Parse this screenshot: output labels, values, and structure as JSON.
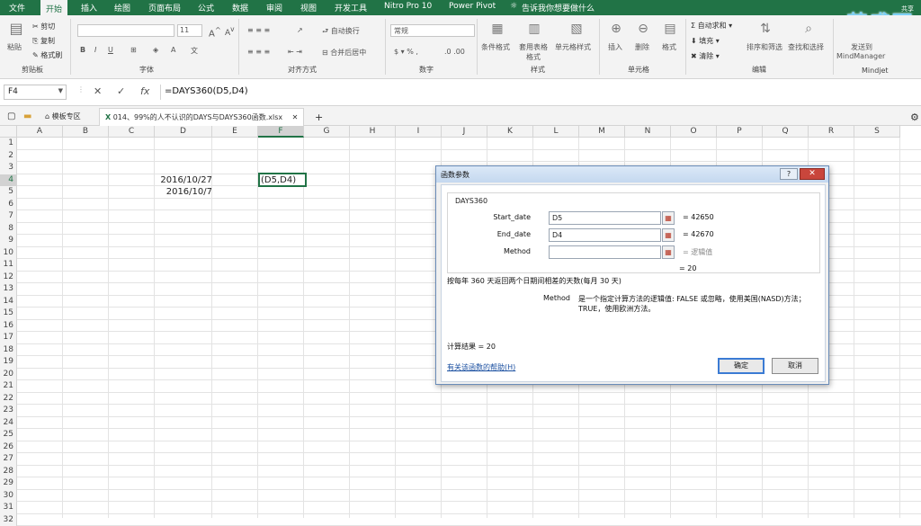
{
  "menu": {
    "tabs": [
      "文件",
      "开始",
      "插入",
      "绘图",
      "页面布局",
      "公式",
      "数据",
      "审阅",
      "视图",
      "开发工具",
      "Nitro Pro 10",
      "Power Pivot"
    ],
    "active": "开始",
    "tell_me": "告诉我你想要做什么",
    "logo": "英盛网",
    "logo_sub": "共享"
  },
  "ribbon": {
    "paste": "粘贴",
    "cut": "剪切",
    "copy": "复制",
    "format_painter": "格式刷",
    "clipboard": "剪贴板",
    "font_size": "11",
    "font_group": "字体",
    "wrap": "自动换行",
    "merge": "合并后居中",
    "align_group": "对齐方式",
    "number_format": "常规",
    "number_group": "数字",
    "cond_format": "条件格式",
    "table_format": "套用表格格式",
    "cell_style": "单元格样式",
    "styles_group": "样式",
    "insert": "插入",
    "delete": "删除",
    "format": "格式",
    "cells_group": "单元格",
    "autosum": "自动求和",
    "fill": "填充",
    "clear": "清除",
    "sort_filter": "排序和筛选",
    "find_select": "查找和选择",
    "edit_group": "编辑",
    "send_to": "发送到",
    "mindmanager": "MindManager",
    "mindjet": "Mindjet"
  },
  "formula_bar": {
    "name_box": "F4",
    "formula": "=DAYS360(D5,D4)"
  },
  "tabs": {
    "template": "模板专区",
    "file": "014、99%的人不认识的DAYS与DAYS360函数.xlsx"
  },
  "grid": {
    "columns": [
      "A",
      "B",
      "C",
      "D",
      "E",
      "F",
      "G",
      "H",
      "I",
      "J",
      "K",
      "L",
      "M",
      "N",
      "O",
      "P",
      "Q",
      "R",
      "S"
    ],
    "rows": [
      "1",
      "2",
      "3",
      "4",
      "5",
      "6",
      "7",
      "8",
      "9",
      "10",
      "11",
      "12",
      "13",
      "14",
      "15",
      "16",
      "17",
      "18",
      "19",
      "20",
      "21",
      "22",
      "23",
      "24",
      "25",
      "26",
      "27",
      "28",
      "29",
      "30",
      "31",
      "32"
    ],
    "selected_col": "F",
    "selected_row": "4",
    "d4": "2016/10/27",
    "d5": "2016/10/7",
    "f4": "(D5,D4)"
  },
  "dialog": {
    "title": "函数参数",
    "function": "DAYS360",
    "args": [
      {
        "label": "Start_date",
        "value": "D5",
        "result": "= 42650"
      },
      {
        "label": "End_date",
        "value": "D4",
        "result": "= 42670"
      },
      {
        "label": "Method",
        "value": "",
        "result": "= 逻辑值"
      }
    ],
    "overall_result": "= 20",
    "description": "按每年 360 天返回两个日期间相差的天数(每月 30 天)",
    "param_name": "Method",
    "param_desc_1": "是一个指定计算方法的逻辑值: FALSE 或忽略，使用美国(NASD)方法；",
    "param_desc_2": "TRUE，使用欧洲方法。",
    "calc_result": "计算结果 =  20",
    "help_link": "有关该函数的帮助(H)",
    "ok": "确定",
    "cancel": "取消",
    "help_btn": "?",
    "close_btn": "✕"
  }
}
